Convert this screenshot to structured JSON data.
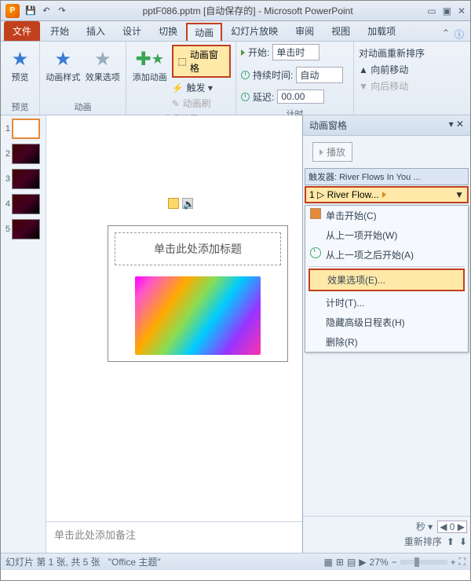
{
  "title": "pptF086.pptm [自动保存的] - Microsoft PowerPoint",
  "tabs": {
    "file": "文件",
    "start": "开始",
    "insert": "插入",
    "design": "设计",
    "trans": "切换",
    "anim": "动画",
    "show": "幻灯片放映",
    "review": "审阅",
    "view": "视图",
    "addin": "加载项"
  },
  "ribbon": {
    "preview": {
      "label": "预览",
      "btn": "预览"
    },
    "anim": {
      "label": "动画",
      "style": "动画样式",
      "opts": "效果选项"
    },
    "adv": {
      "label": "高级动画",
      "add": "添加动画",
      "pane": "动画窗格",
      "trigger": "触发 ▾",
      "painter": "动画刷"
    },
    "timing": {
      "label": "计时",
      "start": "开始:",
      "startv": "单击时",
      "dur": "持续时间:",
      "durv": "自动",
      "delay": "延迟:",
      "delayv": "00.00"
    },
    "reorder": {
      "label": "对动画重新排序",
      "up": "▲ 向前移动",
      "down": "▼ 向后移动"
    }
  },
  "thumbs": [
    "1",
    "2",
    "3",
    "4",
    "5"
  ],
  "slide": {
    "title_ph": "单击此处添加标题"
  },
  "notes": "单击此处添加备注",
  "ap": {
    "title": "动画窗格",
    "play": "播放",
    "trigger": "触发器: River Flows In You ...",
    "item": "1 ▷ River Flow...",
    "ctx": {
      "click": "单击开始(C)",
      "prev": "从上一项开始(W)",
      "after": "从上一项之后开始(A)",
      "effect": "效果选项(E)...",
      "timing": "计时(T)...",
      "hide": "隐藏高级日程表(H)",
      "remove": "删除(R)"
    },
    "sec": "秒 ▾",
    "secv": "0",
    "resort": "重新排序"
  },
  "status": {
    "slide": "幻灯片 第 1 张, 共 5 张",
    "theme": "\"Office 主题\"",
    "zoom": "27%"
  }
}
